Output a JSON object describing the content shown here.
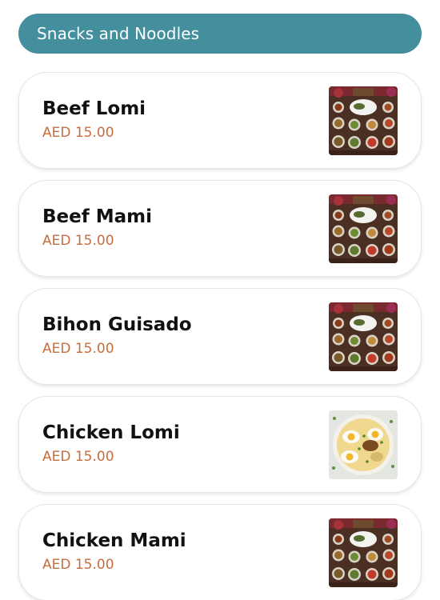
{
  "category": {
    "title": "Snacks and Noodles"
  },
  "items": [
    {
      "name": "Beef Lomi",
      "price": "AED 15.00",
      "image": "platter-image"
    },
    {
      "name": "Beef Mami",
      "price": "AED 15.00",
      "image": "platter-image"
    },
    {
      "name": "Bihon Guisado",
      "price": "AED 15.00",
      "image": "platter-image"
    },
    {
      "name": "Chicken Lomi",
      "price": "AED 15.00",
      "image": "noodle-soup-image"
    },
    {
      "name": "Chicken Mami",
      "price": "AED 15.00",
      "image": "platter-image"
    }
  ],
  "colors": {
    "header_bg": "#438f9e",
    "price": "#c66d3e",
    "name": "#111111"
  }
}
